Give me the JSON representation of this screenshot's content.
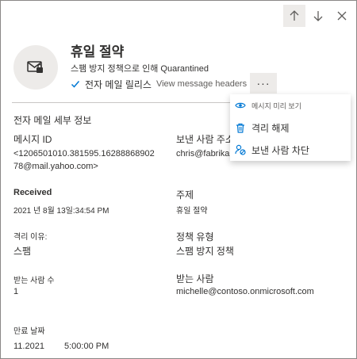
{
  "header": {
    "title": "휴일 절약",
    "subtitle": "스팸 방지 정책으로 인해 Quarantined",
    "checkbox_label": "전자 메일 릴리스",
    "view_headers_link": "View message headers",
    "more_label": "···"
  },
  "nav": {
    "up_icon": "arrow-up-icon",
    "down_icon": "arrow-down-icon",
    "close_icon": "close-icon"
  },
  "dropdown": {
    "items": [
      {
        "label": "메시지 미리 보기",
        "icon": "eye-icon"
      },
      {
        "label": "격리 해제",
        "icon": "trash-icon"
      },
      {
        "label": "보낸 사람 차단",
        "icon": "block-person-icon"
      }
    ]
  },
  "details": {
    "section_title": "전자 메일 세부 정보",
    "message_id_label": "메시지 ID",
    "message_id_value": "<1206501010.381595.1628886890278@mail.yahoo.com>",
    "sender_label": "보낸 사람 주소",
    "sender_value": "chris@fabrikam",
    "received_label": "Received",
    "received_value": "2021 년 8월 13일:34:54 PM",
    "subject_label": "주제",
    "subject_value": "휴일 절약",
    "quarantine_reason_label": "격리 이유:",
    "quarantine_reason_value": "스팸",
    "policy_type_label": "정책 유형",
    "policy_type_value": "스팸 방지 정책",
    "recipient_count_label": "받는 사람 수",
    "recipient_count_value": "1",
    "recipient_label": "받는 사람",
    "recipient_value": "michelle@contoso.onmicrosoft.com",
    "expires_label": "만료 날짜",
    "expires_date": "11.2021",
    "expires_time": "5:00:00 PM"
  },
  "colors": {
    "accent": "#0078d4",
    "border": "#8a8886",
    "button_bg": "#edebe9",
    "text": "#323130"
  }
}
